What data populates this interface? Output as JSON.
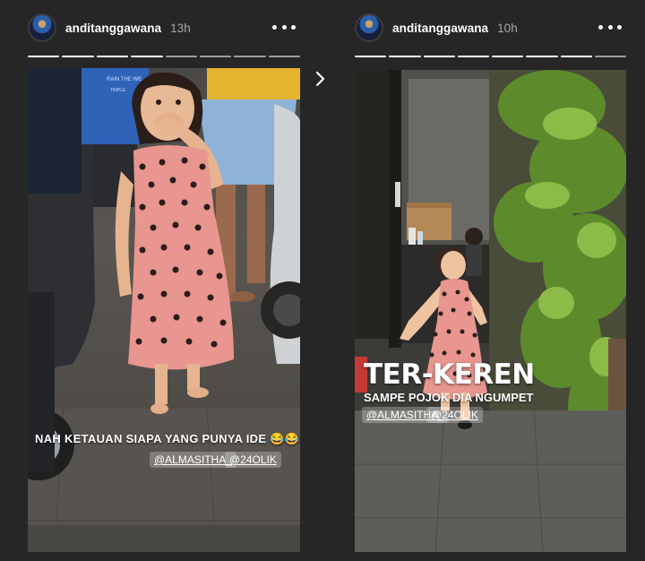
{
  "stories": [
    {
      "username": "anditanggawana",
      "timestamp": "13h",
      "caption": "NAH KETAUAN SIAPA YANG PUNYA IDE 😂😂😂",
      "mentions": [
        "@ALMASITHA_",
        "@24OLIK"
      ],
      "scene_texts": [
        "RAIN THE WE",
        "TRIPLE"
      ]
    },
    {
      "username": "anditanggawana",
      "timestamp": "10h",
      "headline": "TER-KEREN",
      "subheadline": "SAMPE POJOK DIA NGUMPET",
      "mentions": [
        "@ALMASITHA_",
        "@24OLIK"
      ]
    }
  ],
  "icons": {
    "avatar": "user-avatar-icon",
    "more": "more-options-icon",
    "next": "chevron-right-icon"
  },
  "colors": {
    "background": "#262626",
    "progress_done": "#ffffff",
    "progress_pending": "#8a8a8a",
    "dress": "#e8968f"
  }
}
